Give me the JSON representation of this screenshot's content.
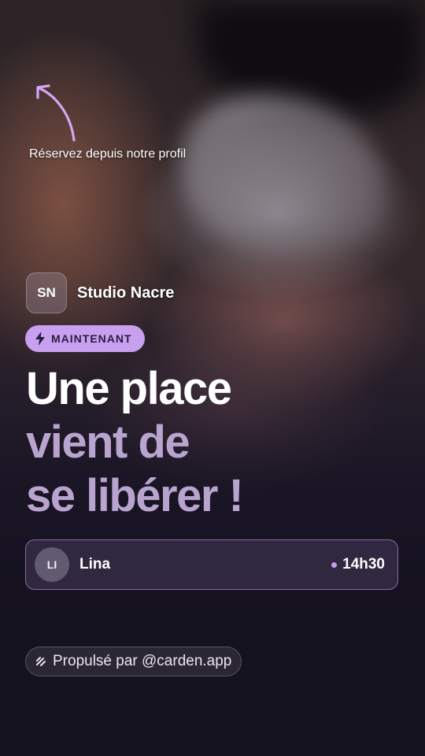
{
  "hint": {
    "text": "Réservez depuis notre profil"
  },
  "studio": {
    "initials": "SN",
    "name": "Studio Nacre"
  },
  "badge": {
    "label": "MAINTENANT",
    "icon": "lightning-icon"
  },
  "headline": {
    "line1": "Une place",
    "line2": "vient de",
    "line3": "se libérer !"
  },
  "slot": {
    "initials": "LI",
    "name": "Lina",
    "time": "14h30"
  },
  "footer": {
    "text": "Propulsé par @carden.app",
    "icon": "carden-logo-icon"
  },
  "colors": {
    "accent": "#c9a0f0",
    "headline_secondary": "#b9a4cf",
    "background": "#15121f"
  }
}
